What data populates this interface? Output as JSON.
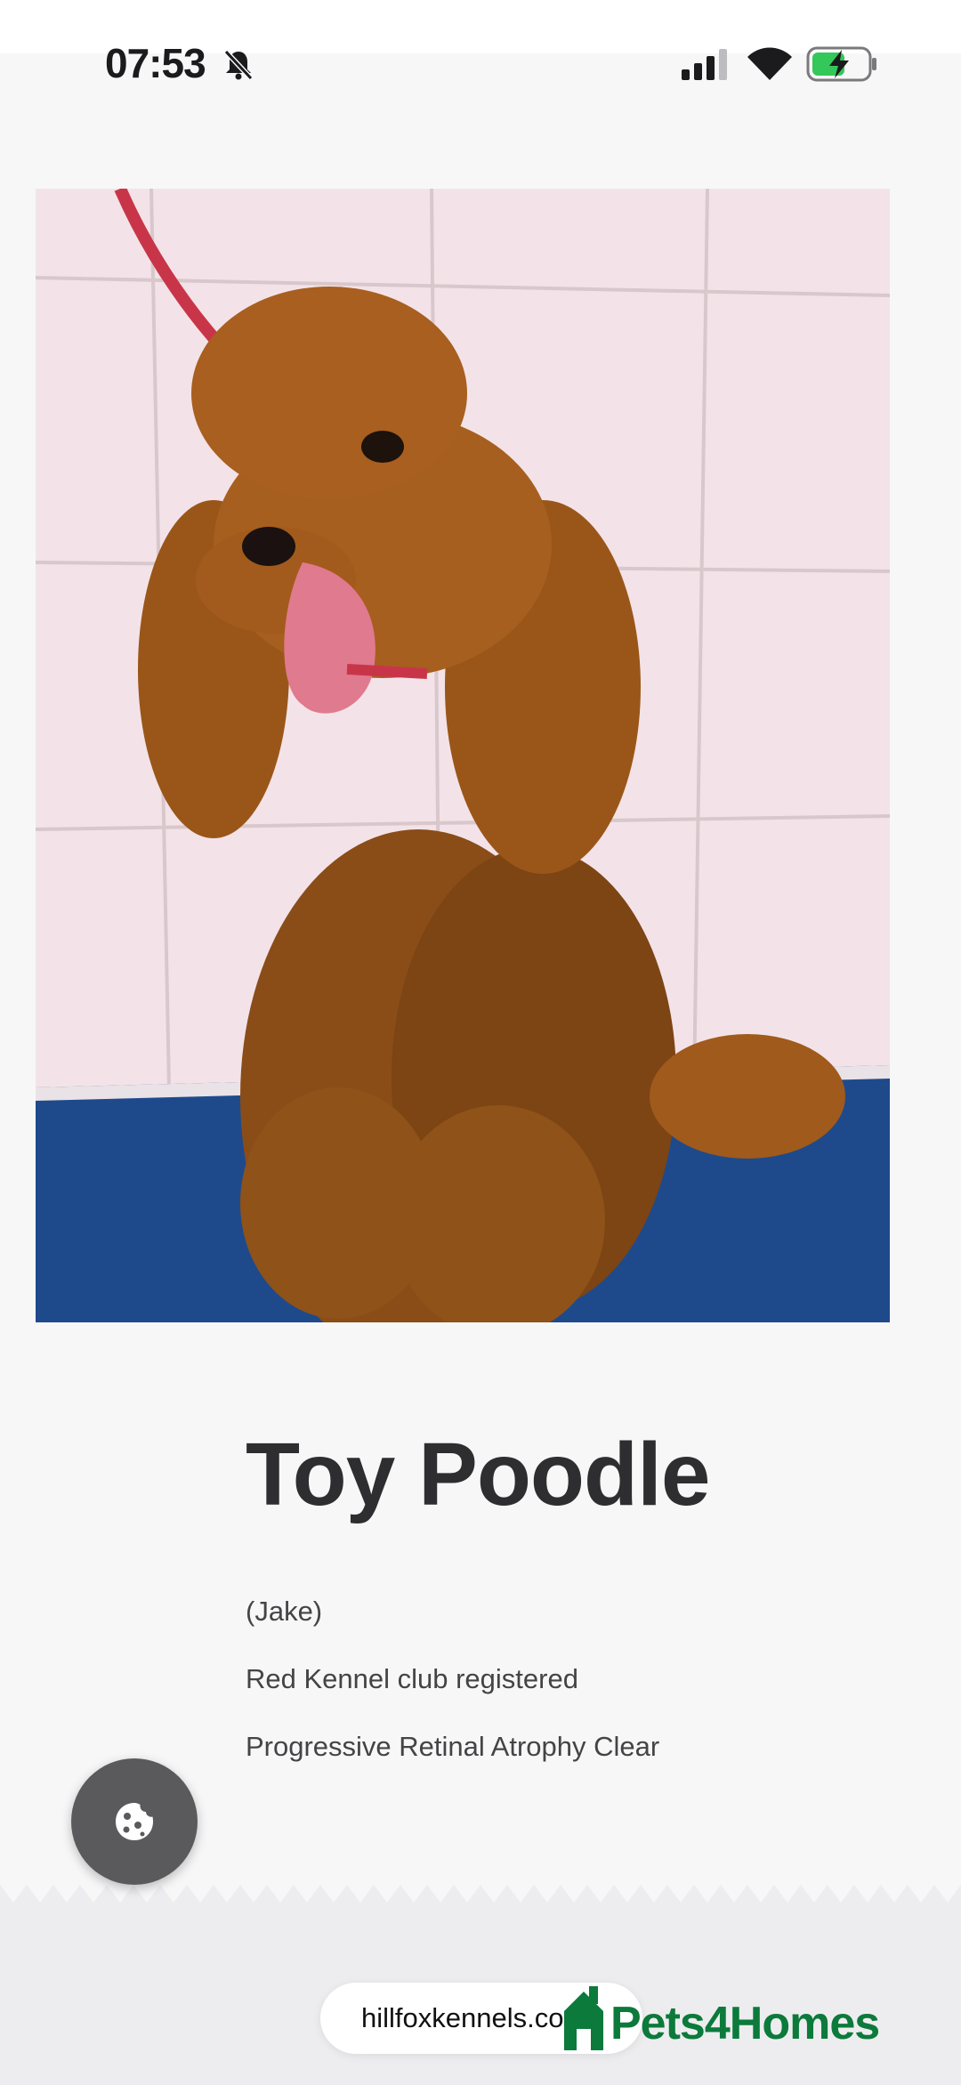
{
  "status_bar": {
    "time": "07:53",
    "icons": [
      "bell-off-icon",
      "signal-icon",
      "wifi-icon",
      "battery-charging-icon"
    ]
  },
  "listing": {
    "image": "toy-poodle-photo",
    "title": "Toy Poodle",
    "details": [
      "(Jake)",
      "Red Kennel club registered",
      "Progressive Retinal Atrophy Clear"
    ]
  },
  "cookie_button": {
    "icon": "cookie-icon"
  },
  "footer": {
    "url": "hillfoxkennels.com",
    "brand": "Pets4Homes",
    "brand_color": "#0b7a3b"
  }
}
